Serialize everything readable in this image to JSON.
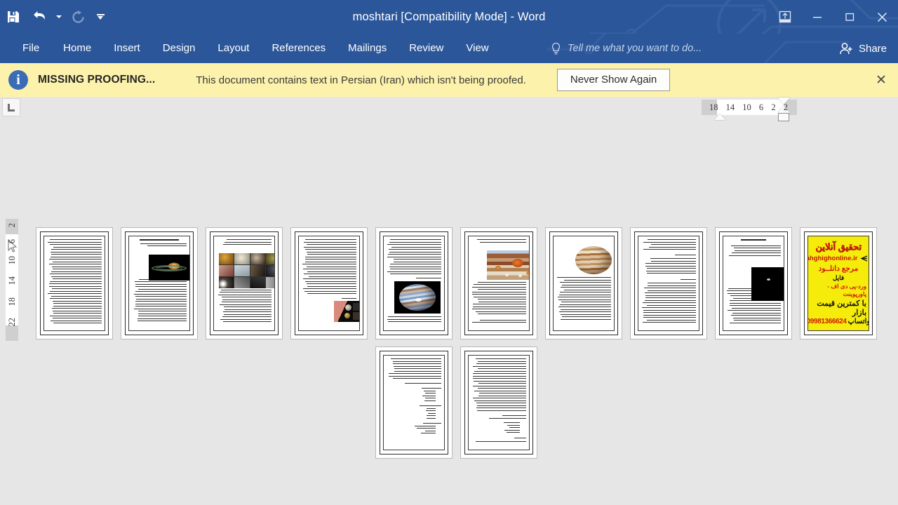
{
  "window": {
    "title": "moshtari [Compatibility Mode] - Word",
    "quick_access": [
      {
        "name": "save",
        "label": "Save",
        "icon": "save-icon",
        "enabled": true
      },
      {
        "name": "undo",
        "label": "Undo",
        "icon": "undo-icon",
        "enabled": true
      },
      {
        "name": "redo",
        "label": "Repeat",
        "icon": "redo-icon",
        "enabled": false
      },
      {
        "name": "customize",
        "label": "Customize Quick Access Toolbar",
        "icon": "chevron-down-icon",
        "enabled": true
      }
    ],
    "controls": [
      {
        "name": "ribbon-display-options",
        "label": "Ribbon Display Options",
        "icon": "ribbon-options-icon"
      },
      {
        "name": "minimize",
        "label": "Minimize",
        "icon": "minimize-icon"
      },
      {
        "name": "restore",
        "label": "Restore Down",
        "icon": "restore-icon"
      },
      {
        "name": "close",
        "label": "Close",
        "icon": "close-icon"
      }
    ]
  },
  "ribbon": {
    "tabs": [
      {
        "id": "file",
        "label": "File"
      },
      {
        "id": "home",
        "label": "Home"
      },
      {
        "id": "insert",
        "label": "Insert"
      },
      {
        "id": "design",
        "label": "Design"
      },
      {
        "id": "layout",
        "label": "Layout"
      },
      {
        "id": "references",
        "label": "References"
      },
      {
        "id": "mailings",
        "label": "Mailings"
      },
      {
        "id": "review",
        "label": "Review"
      },
      {
        "id": "view",
        "label": "View"
      }
    ],
    "tellme": {
      "icon": "lightbulb-icon",
      "placeholder": "Tell me what you want to do..."
    },
    "share": {
      "icon": "share-person-icon",
      "label": "Share"
    }
  },
  "notification": {
    "icon": "info-icon",
    "title": "MISSING PROOFING...",
    "message": "This document contains text in Persian (Iran) which isn't being proofed.",
    "button_label": "Never Show Again",
    "close_label": "✕",
    "background_color": "#fdf2ab",
    "icon_color": "#3a6db5"
  },
  "rulers": {
    "tab_stop_selector": {
      "label": "L",
      "name": "left-tab-stop"
    },
    "horizontal_ticks": [
      "18",
      "14",
      "10",
      "6",
      "2",
      "2"
    ],
    "vertical_ticks": [
      "2",
      "2",
      "6",
      "10",
      "14",
      "18",
      "22"
    ]
  },
  "document": {
    "zoom_view": "multiple-pages",
    "page_count": 12,
    "pages": [
      {
        "number": 1,
        "kind": "text"
      },
      {
        "number": 2,
        "kind": "text-image",
        "image": "saturn-rings"
      },
      {
        "number": 3,
        "kind": "text-image",
        "image": "moon-grid"
      },
      {
        "number": 4,
        "kind": "text-image",
        "image": "moons-compare"
      },
      {
        "number": 5,
        "kind": "text-image",
        "image": "jupiter-blue-bands"
      },
      {
        "number": 6,
        "kind": "text-image",
        "image": "great-red-spot"
      },
      {
        "number": 7,
        "kind": "text-image",
        "image": "jupiter-tan"
      },
      {
        "number": 8,
        "kind": "text"
      },
      {
        "number": 9,
        "kind": "text-image",
        "image": "jupiter-telescope",
        "heading": "مشتری (جهان‌رو)"
      },
      {
        "number": 10,
        "kind": "advertisement"
      },
      {
        "number": 11,
        "kind": "text-list"
      },
      {
        "number": 12,
        "kind": "text-list"
      }
    ],
    "advertisement": {
      "background_color": "#f5ec0c",
      "headline": "تحقیق آنلاین",
      "site": "Tahghighonline.ir",
      "line_download": "مرجع دانلــود",
      "line_file": "فایل",
      "line_formats": "ورد-پی دی اف - پاورپوینت",
      "line_price": "با کمترین قیمت بازار",
      "phone": "09981366624",
      "whatsapp": "واتساپ"
    }
  }
}
